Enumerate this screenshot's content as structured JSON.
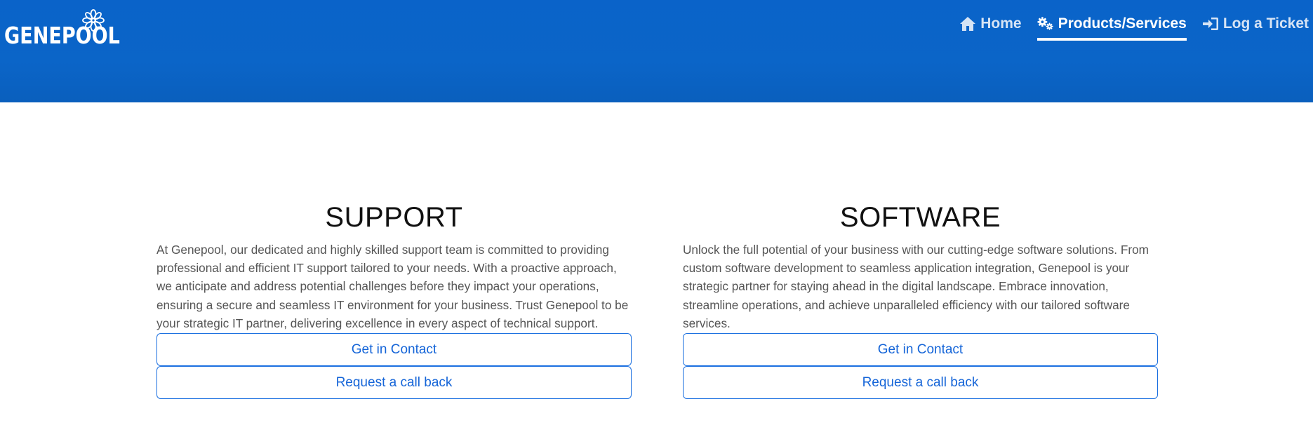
{
  "brand": {
    "name": "GENEPOOL",
    "logo_icon": "flower-icon",
    "header_color": "#0b65c8"
  },
  "nav": {
    "items": [
      {
        "label": "Home",
        "icon": "home-icon",
        "active": false
      },
      {
        "label": "Products/Services",
        "icon": "gears-icon",
        "active": true
      },
      {
        "label": "Log a Ticket",
        "icon": "sign-in-icon",
        "active": false
      }
    ]
  },
  "sections": [
    {
      "title": "SUPPORT",
      "body": "At Genepool, our dedicated and highly skilled support team is committed to providing professional and efficient IT support tailored to your needs. With a proactive approach, we anticipate and address potential challenges before they impact your operations, ensuring a secure and seamless IT environment for your business. Trust Genepool to be your strategic IT partner, delivering excellence in every aspect of technical support.",
      "contact_label": "Get in Contact",
      "callback_label": "Request a call back"
    },
    {
      "title": "SOFTWARE",
      "body": "Unlock the full potential of your business with our cutting-edge software solutions. From custom software development to seamless application integration, Genepool is your strategic partner for staying ahead in the digital landscape. Embrace innovation, streamline operations, and achieve unparalleled efficiency with our tailored software services.",
      "contact_label": "Get in Contact",
      "callback_label": "Request a call back"
    }
  ],
  "colors": {
    "accent": "#1565d8",
    "heading": "#111111",
    "body_text": "#555555"
  }
}
